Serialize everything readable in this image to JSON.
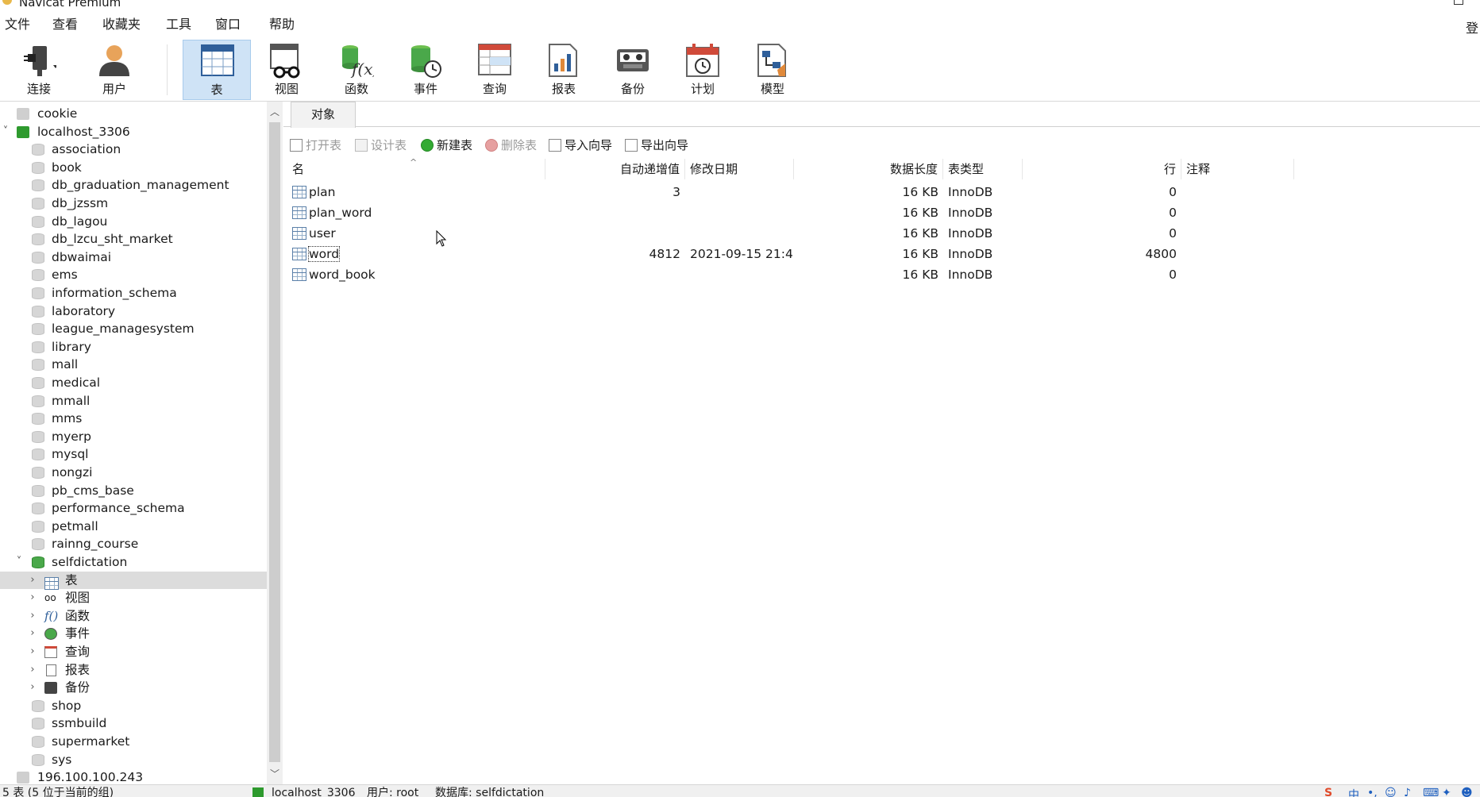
{
  "window": {
    "title": "Navicat Premium"
  },
  "menu": {
    "items": [
      "文件",
      "查看",
      "收藏夹",
      "工具",
      "窗口",
      "帮助"
    ],
    "login_label": "登"
  },
  "toolbar": {
    "buttons": [
      {
        "label": "连接",
        "icon": "plug-icon"
      },
      {
        "label": "用户",
        "icon": "user-icon"
      },
      {
        "label": "表",
        "icon": "table-icon",
        "active": true
      },
      {
        "label": "视图",
        "icon": "view-glasses-icon"
      },
      {
        "label": "函数",
        "icon": "function-icon"
      },
      {
        "label": "事件",
        "icon": "event-clock-icon"
      },
      {
        "label": "查询",
        "icon": "query-icon"
      },
      {
        "label": "报表",
        "icon": "report-icon"
      },
      {
        "label": "备份",
        "icon": "backup-icon"
      },
      {
        "label": "计划",
        "icon": "schedule-calendar-icon"
      },
      {
        "label": "模型",
        "icon": "model-icon"
      }
    ]
  },
  "tree": {
    "items": [
      {
        "label": "cookie"
      },
      {
        "label": "localhost_3306"
      },
      {
        "label": "association"
      },
      {
        "label": "book"
      },
      {
        "label": "db_graduation_management"
      },
      {
        "label": "db_jzssm"
      },
      {
        "label": "db_lagou"
      },
      {
        "label": "db_lzcu_sht_market"
      },
      {
        "label": "dbwaimai"
      },
      {
        "label": "ems"
      },
      {
        "label": "information_schema"
      },
      {
        "label": "laboratory"
      },
      {
        "label": "league_managesystem"
      },
      {
        "label": "library"
      },
      {
        "label": "mall"
      },
      {
        "label": "medical"
      },
      {
        "label": "mmall"
      },
      {
        "label": "mms"
      },
      {
        "label": "myerp"
      },
      {
        "label": "mysql"
      },
      {
        "label": "nongzi"
      },
      {
        "label": "pb_cms_base"
      },
      {
        "label": "performance_schema"
      },
      {
        "label": "petmall"
      },
      {
        "label": "rainng_course"
      },
      {
        "label": "selfdictation"
      },
      {
        "label": "表"
      },
      {
        "label": "视图"
      },
      {
        "label": "函数"
      },
      {
        "label": "事件"
      },
      {
        "label": "查询"
      },
      {
        "label": "报表"
      },
      {
        "label": "备份"
      },
      {
        "label": "shop"
      },
      {
        "label": "ssmbuild"
      },
      {
        "label": "supermarket"
      },
      {
        "label": "sys"
      },
      {
        "label": "196.100.100.243"
      }
    ]
  },
  "objects_tab": {
    "label": "对象"
  },
  "object_toolbar": {
    "open_table": "打开表",
    "design_table": "设计表",
    "new_table": "新建表",
    "delete_table": "删除表",
    "import_wizard": "导入向导",
    "export_wizard": "导出向导"
  },
  "table_list": {
    "columns": [
      "名",
      "自动递增值",
      "修改日期",
      "数据长度",
      "表类型",
      "行",
      "注释"
    ],
    "rows": [
      {
        "name": "plan",
        "auto_inc": "3",
        "modified": "",
        "data_length": "16 KB",
        "engine": "InnoDB",
        "rows": "0",
        "comment": ""
      },
      {
        "name": "plan_word",
        "auto_inc": "",
        "modified": "",
        "data_length": "16 KB",
        "engine": "InnoDB",
        "rows": "0",
        "comment": ""
      },
      {
        "name": "user",
        "auto_inc": "",
        "modified": "",
        "data_length": "16 KB",
        "engine": "InnoDB",
        "rows": "0",
        "comment": ""
      },
      {
        "name": "word",
        "auto_inc": "4812",
        "modified": "2021-09-15 21:4...",
        "data_length": "16 KB",
        "engine": "InnoDB",
        "rows": "4800",
        "comment": ""
      },
      {
        "name": "word_book",
        "auto_inc": "",
        "modified": "",
        "data_length": "16 KB",
        "engine": "InnoDB",
        "rows": "0",
        "comment": ""
      }
    ]
  },
  "status": {
    "left": "5 表 (5 位于当前的组)",
    "connection": "localhost_3306",
    "user": "用户: root",
    "database": "数据库: selfdictation"
  },
  "colors": {
    "accent": "#cfe3f6",
    "selection": "#dcdcdc",
    "db_open": "#4aa84a"
  }
}
